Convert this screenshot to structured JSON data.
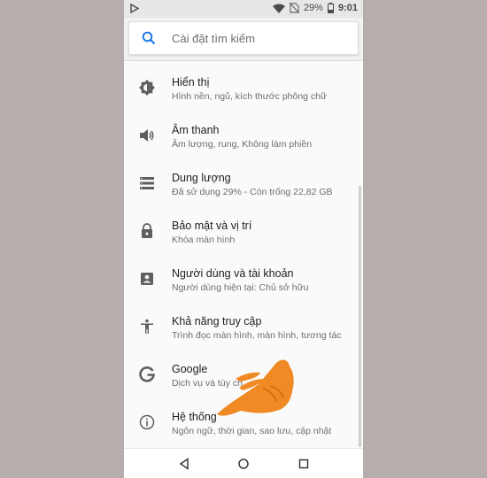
{
  "status": {
    "battery": "29%",
    "time": "9:01"
  },
  "search": {
    "placeholder": "Cài đặt tìm kiếm"
  },
  "items": [
    {
      "icon": "brightness-icon",
      "title": "Hiển thị",
      "subtitle": "Hình nền, ngủ, kích thước phông chữ"
    },
    {
      "icon": "volume-icon",
      "title": "Âm thanh",
      "subtitle": "Âm lượng, rung, Không làm phiền"
    },
    {
      "icon": "storage-icon",
      "title": "Dung lượng",
      "subtitle": "Đã sử dụng 29% - Còn trống 22,82 GB"
    },
    {
      "icon": "lock-icon",
      "title": "Bảo mật và vị trí",
      "subtitle": "Khóa màn hình"
    },
    {
      "icon": "account-icon",
      "title": "Người dùng và tài khoản",
      "subtitle": "Người dùng hiện tại: Chủ sở hữu"
    },
    {
      "icon": "accessibility-icon",
      "title": "Khả năng truy cập",
      "subtitle": "Trình đọc màn hình, màn hình, tương tác"
    },
    {
      "icon": "google-icon",
      "title": "Google",
      "subtitle": "Dịch vụ và tùy ch"
    },
    {
      "icon": "info-icon",
      "title": "Hệ thống",
      "subtitle": "Ngôn ngữ, thời gian, sao lưu, cập nhật"
    }
  ],
  "colors": {
    "background": "#b6adac",
    "accent": "#1a73e8",
    "hand": "#f08a24"
  }
}
